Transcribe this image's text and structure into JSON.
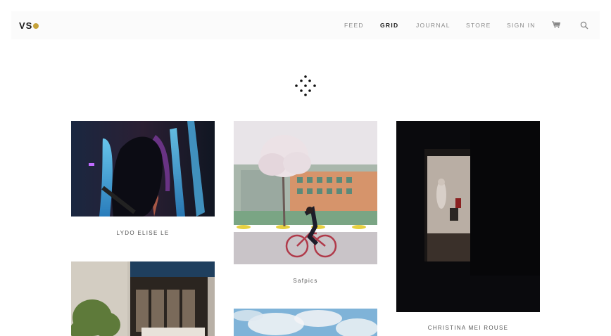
{
  "nav": {
    "logo": "VS",
    "links": [
      "FEED",
      "GRID",
      "JOURNAL",
      "STORE",
      "SIGN IN"
    ],
    "active": "GRID",
    "icons": [
      "cart-icon",
      "search-icon"
    ]
  },
  "grid_icon": "grid-dots-icon",
  "photos": [
    {
      "caption": "LYDO ELISE LE"
    },
    {
      "caption": "Safpics"
    },
    {
      "caption": "CHRISTINA MEI ROUSE"
    },
    {
      "caption": ""
    },
    {
      "caption": ""
    }
  ],
  "colors": {
    "accent": "#c5a23a",
    "text": "#1b1b1b",
    "muted": "#8a8a8a"
  }
}
